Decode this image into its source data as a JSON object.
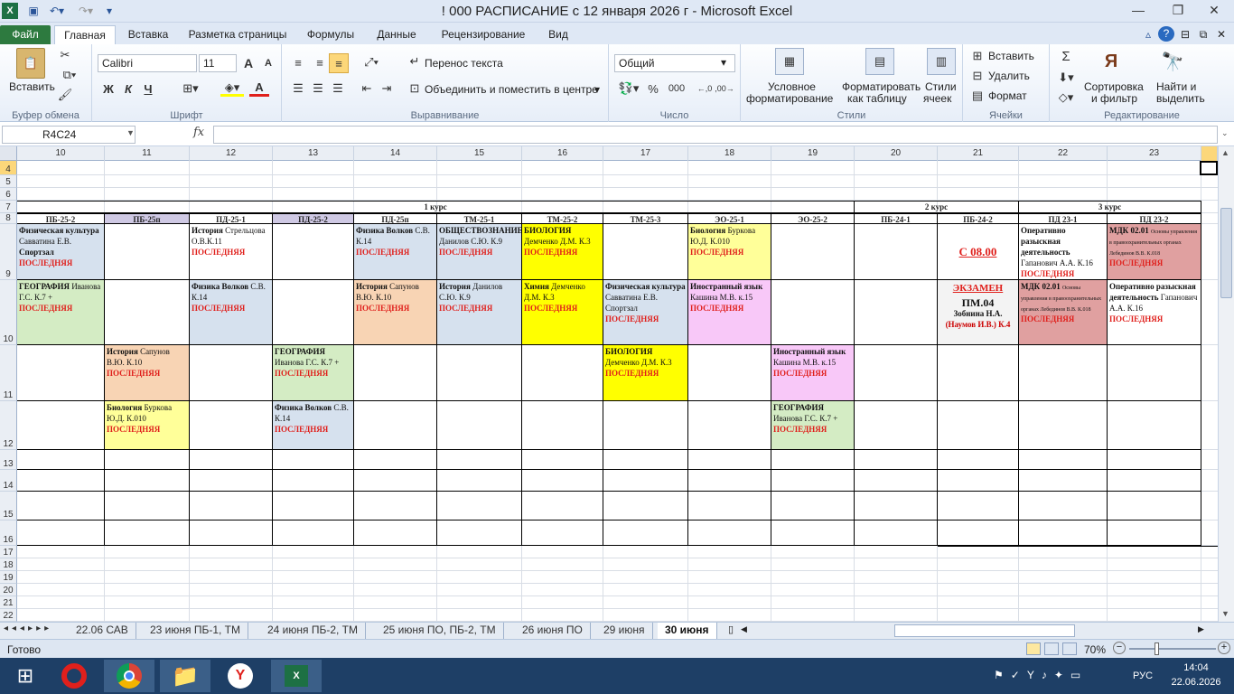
{
  "window": {
    "title": "! 000 РАСПИСАНИЕ с 12 января 2026 г  -  Microsoft Excel"
  },
  "ribbon_tabs": [
    "Файл",
    "Главная",
    "Вставка",
    "Разметка страницы",
    "Формулы",
    "Данные",
    "Рецензирование",
    "Вид"
  ],
  "clipboard": {
    "paste": "Вставить",
    "group": "Буфер обмена"
  },
  "font": {
    "name": "Calibri",
    "size": "11",
    "group": "Шрифт",
    "bold": "Ж",
    "italic": "К",
    "underline": "Ч",
    "grow": "A",
    "shrink": "A",
    "color": "A"
  },
  "align": {
    "wrap": "Перенос текста",
    "merge": "Объединить и поместить в центре",
    "group": "Выравнивание"
  },
  "number": {
    "format": "Общий",
    "percent": "%",
    "thousands": "000",
    "group": "Число"
  },
  "styles": {
    "cond1": "Условное",
    "cond2": "форматирование",
    "table1": "Форматировать",
    "table2": "как таблицу",
    "cell1": "Стили",
    "cell2": "ячеек",
    "group": "Стили"
  },
  "cells": {
    "insert": "Вставить",
    "delete": "Удалить",
    "format": "Формат",
    "group": "Ячейки"
  },
  "edit": {
    "sort1": "Сортировка",
    "sort2": "и фильтр",
    "find1": "Найти и",
    "find2": "выделить",
    "group": "Редактирование",
    "sum": "Σ"
  },
  "formula_bar": {
    "name_box": "R4C24",
    "fx": "fx",
    "content": ""
  },
  "columns": [
    "10",
    "11",
    "12",
    "13",
    "14",
    "15",
    "16",
    "17",
    "18",
    "19",
    "20",
    "21",
    "22",
    "23"
  ],
  "rows": [
    "4",
    "5",
    "6",
    "7",
    "8",
    "9",
    "10",
    "11",
    "12",
    "13",
    "14",
    "15",
    "16",
    "17",
    "18",
    "19",
    "20",
    "21",
    "22"
  ],
  "courses": [
    "1 курс",
    "2 курс",
    "3 курс"
  ],
  "groups": [
    "ПБ-25-2",
    "ПБ-25п",
    "ПД-25-1",
    "ПД-25-2",
    "ПД-25п",
    "ТМ-25-1",
    "ТМ-25-2",
    "ТМ-25-3",
    "ЭО-25-1",
    "ЭО-25-2",
    "ПБ-24-1",
    "ПБ-24-2",
    "ПД 23-1",
    "ПД 23-2"
  ],
  "lessons": [
    {
      "b": "Физическая культура",
      "t": "Савватина Е.В.",
      "b2": "Спортзал",
      "last": "ПОСЛЕДНЯЯ"
    },
    {
      "b": "История",
      "t": "Стрельцова О.В.К.11",
      "last": "ПОСЛЕДНЯЯ"
    },
    {
      "b": "Физика  Волков",
      "t": "С.В. К.14",
      "last": "ПОСЛЕДНЯЯ"
    },
    {
      "b": "ОБЩЕСТВОЗНАНИЕ",
      "t": "Данилов С.Ю. К.9",
      "last": "ПОСЛЕДНЯЯ"
    },
    {
      "b": "БИОЛОГИЯ",
      "t": "Демченко Д.М. К.3",
      "last": "ПОСЛЕДНЯЯ"
    },
    {
      "b": "Биология",
      "t": "Бурковa Ю.Д. К.010",
      "last": "ПОСЛЕДНЯЯ"
    },
    {
      "t": "С 08.00"
    },
    {
      "b": "Оперативно разыскная деятельность",
      "t": "Гапанович А.А. К.16",
      "last": "ПОСЛЕДНЯЯ"
    },
    {
      "b": "МДК 02.01",
      "t": "Основы управления в правоохранительных органах Лебединов В.В. К.018",
      "last": "ПОСЛЕДНЯЯ"
    },
    {
      "b": "ГЕОГРАФИЯ",
      "t": "Иванова Г.С. К.7 +",
      "last": "ПОСЛЕДНЯЯ"
    },
    {
      "b": "Физика  Волков",
      "t": "С.В. К.14",
      "last": "ПОСЛЕДНЯЯ"
    },
    {
      "b": "История",
      "t": "Сапунов В.Ю. К.10",
      "last": "ПОСЛЕДНЯЯ"
    },
    {
      "b": "История",
      "t": "Данилов С.Ю. К.9",
      "last": "ПОСЛЕДНЯЯ"
    },
    {
      "b": "Химия",
      "t": "Демченко Д.М. К.3",
      "last": "ПОСЛЕДНЯЯ"
    },
    {
      "b": "Физическая культура",
      "t": "Савватина Е.В. Спортзал",
      "last": "ПОСЛЕДНЯЯ"
    },
    {
      "b": "Иностранный язык",
      "t": "Кашина М.В. к.15",
      "last": "ПОСЛЕДНЯЯ"
    },
    {
      "t": "ЭКЗАМЕН",
      "b2": "ПМ.04",
      "t2": "Зобнина Н.А.",
      "t3": "(Наумов И.В.) К.4"
    },
    {
      "b": "МДК 02.01",
      "t": "Основы управления в правоохранительных органах Лебединов В.В. К.018",
      "last": "ПОСЛЕДНЯЯ"
    },
    {
      "b": "Оперативно разыскная деятельность",
      "t": "Гапанович А.А. К.16",
      "last": "ПОСЛЕДНЯЯ"
    },
    {
      "b": "История",
      "t": "Сапунов В.Ю. К.10",
      "last": "ПОСЛЕДНЯЯ"
    },
    {
      "b": "ГЕОГРАФИЯ",
      "t": "Иванова Г.С. К.7 +",
      "last": "ПОСЛЕДНЯЯ"
    },
    {
      "b": "БИОЛОГИЯ",
      "t": "Демченко Д.М. К.3",
      "last": "ПОСЛЕДНЯЯ"
    },
    {
      "b": "Иностранный язык",
      "t": "Кашина М.В. к.15",
      "last": "ПОСЛЕДНЯЯ"
    },
    {
      "b": "Биология",
      "t": "Бурковa Ю.Д. К.010",
      "last": "ПОСЛЕДНЯЯ"
    },
    {
      "b": "Физика  Волков",
      "t": "С.В. К.14",
      "last": "ПОСЛЕДНЯЯ"
    },
    {
      "b": "ГЕОГРАФИЯ",
      "t": "Иванова Г.С. К.7 +",
      "last": "ПОСЛЕДНЯЯ"
    }
  ],
  "sheet_tabs": [
    "22.06 САВ",
    "23 июня ПБ-1, ТМ",
    "24 июня ПБ-2, ТМ",
    "25 июня ПО, ПБ-2, ТМ",
    "26 июня ПО",
    "29 июня",
    "30 июня"
  ],
  "status": {
    "ready": "Готово",
    "zoom": "70%"
  },
  "tray": {
    "lang": "РУС",
    "time": "14:04",
    "date": "22.06.2026"
  },
  "colors": {
    "blue": "#d6e1ee",
    "lavender": "#cfc9e4",
    "green": "#d4ecc4",
    "orange": "#f8d4b4",
    "yellow": "#ffff00",
    "lightyellow": "#ffff99",
    "pink": "#f8c8f8",
    "red": "#e0a0a0",
    "accent": "#2d7a3f"
  }
}
